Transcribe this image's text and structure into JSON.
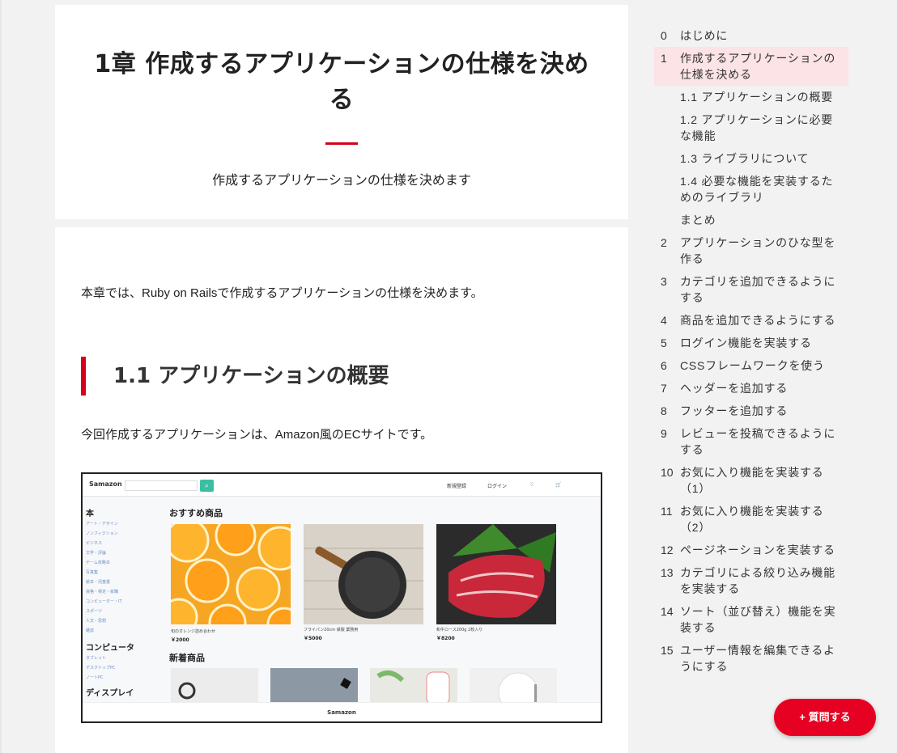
{
  "hero": {
    "title": "1章 作成するアプリケーションの仕様を決める",
    "subtitle": "作成するアプリケーションの仕様を決めます"
  },
  "content": {
    "intro": "本章では、Ruby on Railsで作成するアプリケーションの仕様を決めます。",
    "section_title": "1.1 アプリケーションの概要",
    "lead": "今回作成するアプリケーションは、Amazon風のECサイトです。"
  },
  "screenshot": {
    "logo": "Samazon",
    "nav": [
      "新規登録",
      "ログイン",
      "♡",
      "🛒"
    ],
    "sidebar": [
      {
        "heading": "本",
        "links": [
          "アート・デザイン",
          "ノンフィクション",
          "ビジネス",
          "文学・評論",
          "ゲーム攻略本",
          "写真集",
          "絵本・児童書",
          "資格・検定・就職",
          "コンピューター・IT",
          "スポーツ",
          "人文・思想",
          "雑誌"
        ]
      },
      {
        "heading": "コンピュータ",
        "links": [
          "タブレット",
          "デスクトップPC",
          "ノートPC"
        ]
      },
      {
        "heading": "ディスプレイ",
        "links": []
      }
    ],
    "recommended_heading": "おすすめ商品",
    "products": [
      {
        "name": "旬のオレンジ詰め合わせ",
        "price": "￥2000"
      },
      {
        "name": "フライパン20cm 鉄製 業務用",
        "price": "￥5000"
      },
      {
        "name": "和牛ロース200g 2枚入り",
        "price": "￥8200"
      }
    ],
    "new_heading": "新着商品",
    "footer_logo": "Samazon"
  },
  "toc": [
    {
      "num": "0",
      "label": "はじめに",
      "active": false,
      "sub": false
    },
    {
      "num": "1",
      "label": "作成するアプリケーションの仕様を決める",
      "active": true,
      "sub": false
    },
    {
      "num": "",
      "label": "1.1 アプリケーションの概要",
      "active": false,
      "sub": true
    },
    {
      "num": "",
      "label": "1.2 アプリケーションに必要な機能",
      "active": false,
      "sub": true
    },
    {
      "num": "",
      "label": "1.3 ライブラリについて",
      "active": false,
      "sub": true
    },
    {
      "num": "",
      "label": "1.4 必要な機能を実装するためのライブラリ",
      "active": false,
      "sub": true
    },
    {
      "num": "",
      "label": "まとめ",
      "active": false,
      "sub": true
    },
    {
      "num": "2",
      "label": "アプリケーションのひな型を作る",
      "active": false,
      "sub": false
    },
    {
      "num": "3",
      "label": "カテゴリを追加できるようにする",
      "active": false,
      "sub": false
    },
    {
      "num": "4",
      "label": "商品を追加できるようにする",
      "active": false,
      "sub": false
    },
    {
      "num": "5",
      "label": "ログイン機能を実装する",
      "active": false,
      "sub": false
    },
    {
      "num": "6",
      "label": "CSSフレームワークを使う",
      "active": false,
      "sub": false
    },
    {
      "num": "7",
      "label": "ヘッダーを追加する",
      "active": false,
      "sub": false
    },
    {
      "num": "8",
      "label": "フッターを追加する",
      "active": false,
      "sub": false
    },
    {
      "num": "9",
      "label": "レビューを投稿できるようにする",
      "active": false,
      "sub": false
    },
    {
      "num": "10",
      "label": "お気に入り機能を実装する（1）",
      "active": false,
      "sub": false
    },
    {
      "num": "11",
      "label": "お気に入り機能を実装する（2）",
      "active": false,
      "sub": false
    },
    {
      "num": "12",
      "label": "ページネーションを実装する",
      "active": false,
      "sub": false
    },
    {
      "num": "13",
      "label": "カテゴリによる絞り込み機能を実装する",
      "active": false,
      "sub": false
    },
    {
      "num": "14",
      "label": "ソート（並び替え）機能を実装する",
      "active": false,
      "sub": false
    },
    {
      "num": "15",
      "label": "ユーザー情報を編集できるようにする",
      "active": false,
      "sub": false
    }
  ],
  "fab": {
    "label": "+ 質問する"
  },
  "colors": {
    "accent": "#d7001b",
    "active_bg": "#fce3e6",
    "fab": "#e60021"
  }
}
